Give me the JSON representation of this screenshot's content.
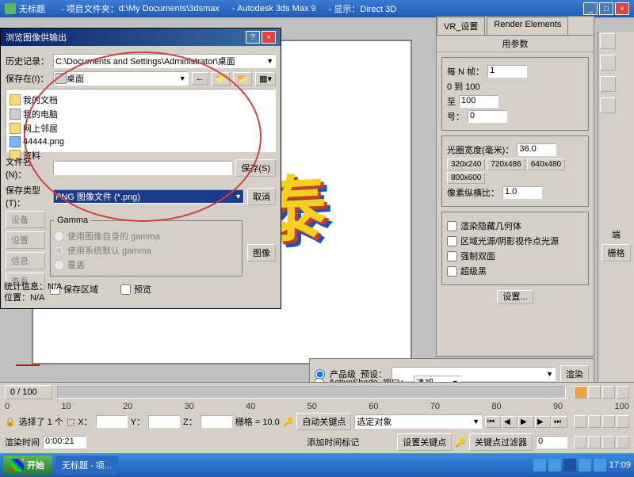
{
  "app": {
    "title_prefix": "无标题",
    "project_label": "- 项目文件夹：",
    "project_path": "d:\\My Documents\\3dsmax",
    "product": "- Autodesk 3ds Max 9",
    "display_label": "- 显示",
    "display_value": "：Direct 3D"
  },
  "viewport_text": "泰",
  "render_panel": {
    "tabs": [
      "VR_设置",
      "Render Elements"
    ],
    "group_title": "用参数",
    "every_n_label": "每 N 帧：",
    "every_n_value": "1",
    "range_label": "0 到 100",
    "to_label": "至",
    "to_value": "100",
    "num_label": "号：",
    "num_value": "0",
    "aperture_label": "光圈宽度(毫米)：",
    "aperture_value": "36.0",
    "presets": [
      "320x240",
      "720x486",
      "640x480",
      "800x600"
    ],
    "pixel_aspect_label": "像素纵横比：",
    "pixel_aspect_value": "1.0",
    "hide_geom_label": "渲染隐藏几何体",
    "area_light_label": "区域光源/阴影视作点光源",
    "force_double_label": "强制双面",
    "super_black_label": "超级黑",
    "settings_btn": "设置...",
    "production_label": "产品级",
    "activeshade_label": "ActiveShade",
    "preset_label": "预设：",
    "viewport_label": "视口：",
    "viewport_value": "透视",
    "render_btn": "渲染"
  },
  "save_dialog": {
    "title": "浏览图像供输出",
    "history_label": "历史记录：",
    "history_value": "C:\\Documents and Settings\\Administrator\\桌面",
    "savein_label": "保存在(I)：",
    "savein_value": "桌面",
    "files": [
      {
        "icon": "folder",
        "name": "我的文档"
      },
      {
        "icon": "pc",
        "name": "我的电脑"
      },
      {
        "icon": "folder",
        "name": "网上邻居"
      },
      {
        "icon": "png",
        "name": "44444.png"
      },
      {
        "icon": "folder",
        "name": "资料"
      }
    ],
    "filename_label": "文件名(N)：",
    "filetype_label": "保存类型(T)：",
    "filetype_value": "PNG 图像文件 (*.png)",
    "save_btn": "保存(S)",
    "cancel_btn": "取消",
    "gamma_title": "Gamma",
    "gamma_own": "使用图像自身的 gamma",
    "gamma_system": "使用系统默认 gamma",
    "gamma_override": "覆盖",
    "image_btn": "图像",
    "save_region": "保存区域",
    "preview": "预览",
    "left_buttons": [
      "设备",
      "设置",
      "信息",
      "查看"
    ],
    "stats_label": "统计信息：",
    "stats_value": "N/A",
    "loc_label": "位置：",
    "loc_value": "N/A"
  },
  "timeline": {
    "range": "0 / 100",
    "marks": [
      "0",
      "10",
      "20",
      "30",
      "40",
      "50",
      "60",
      "70",
      "80",
      "90",
      "100"
    ],
    "selected_label": "选择了 1 个",
    "x_label": "X：",
    "y_label": "Y：",
    "z_label": "Z：",
    "grid_label": "栅格 = 10.0",
    "autokey_label": "自动关键点",
    "autokey_value": "选定对象",
    "setkey_label": "设置关键点",
    "keyfilter_label": "关键点过滤器",
    "render_time_label": "渲染时间",
    "render_time_value": "0:00:21",
    "addtime_label": "添加时间标记"
  },
  "taskbar": {
    "start": "开始",
    "task1": "无标题  - 项...",
    "time": "17:09"
  },
  "side": {
    "end_label": "端",
    "grid_label": "栅格"
  }
}
